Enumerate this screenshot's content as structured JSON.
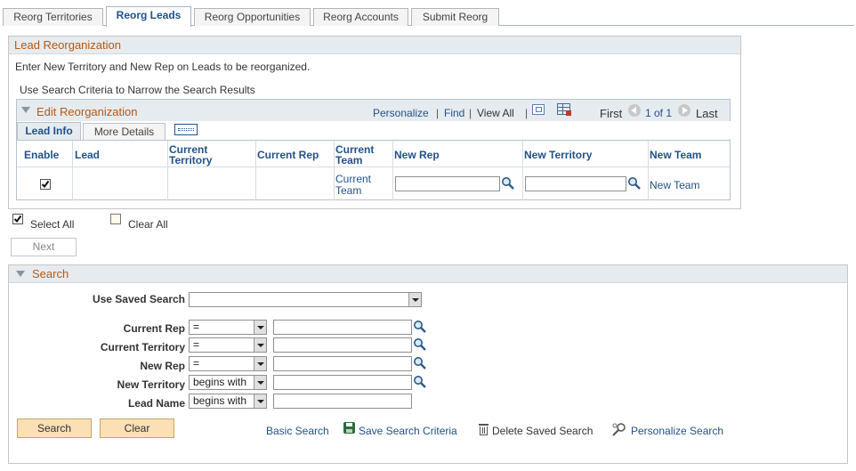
{
  "tabs": [
    {
      "label": "Reorg Territories"
    },
    {
      "label": "Reorg Leads"
    },
    {
      "label": "Reorg Opportunities"
    },
    {
      "label": "Reorg Accounts"
    },
    {
      "label": "Submit Reorg"
    }
  ],
  "lead_reorg": {
    "title": "Lead Reorganization",
    "instruction": "Enter New Territory and New Rep on Leads to be reorganized.",
    "search_hint": "Use Search Criteria to Narrow the Search Results"
  },
  "grid": {
    "title": "Edit Reorganization",
    "personalize": "Personalize",
    "find": "Find",
    "view_all": "View All",
    "sep": "|",
    "first": "First",
    "page_info": "1 of 1",
    "last": "Last",
    "subtabs": [
      "Lead Info",
      "More Details"
    ],
    "columns": {
      "enable": "Enable",
      "lead": "Lead",
      "current_territory": "Current Territory",
      "current_rep": "Current Rep",
      "current_team": "Current Team",
      "new_rep": "New Rep",
      "new_territory": "New Territory",
      "new_team": "New Team"
    },
    "row": {
      "enabled": true,
      "lead": "",
      "current_territory": "",
      "current_rep": "",
      "current_team": "Current Team",
      "new_rep": "",
      "new_territory": "",
      "new_team": "New Team"
    }
  },
  "select_all": "Select All",
  "clear_all": "Clear All",
  "next": "Next",
  "search": {
    "title": "Search",
    "use_saved_search": "Use Saved Search",
    "saved_search_value": "",
    "fields": [
      {
        "label": "Current Rep",
        "operator": "=",
        "value": "",
        "lookup": true
      },
      {
        "label": "Current Territory",
        "operator": "=",
        "value": "",
        "lookup": true
      },
      {
        "label": "New Rep",
        "operator": "=",
        "value": "",
        "lookup": true
      },
      {
        "label": "New Territory",
        "operator": "begins with",
        "value": "",
        "lookup": true
      },
      {
        "label": "Lead Name",
        "operator": "begins with",
        "value": "",
        "lookup": false
      }
    ],
    "search_button": "Search",
    "clear_button": "Clear",
    "basic_search": "Basic Search",
    "save_criteria": "Save Search Criteria",
    "delete_saved": "Delete Saved Search",
    "personalize_search": "Personalize Search"
  },
  "colors": {
    "link": "#22528a",
    "section_title": "#b45915",
    "header_bg": "#e6ebf0",
    "button_bg": "#fbdfb5"
  }
}
